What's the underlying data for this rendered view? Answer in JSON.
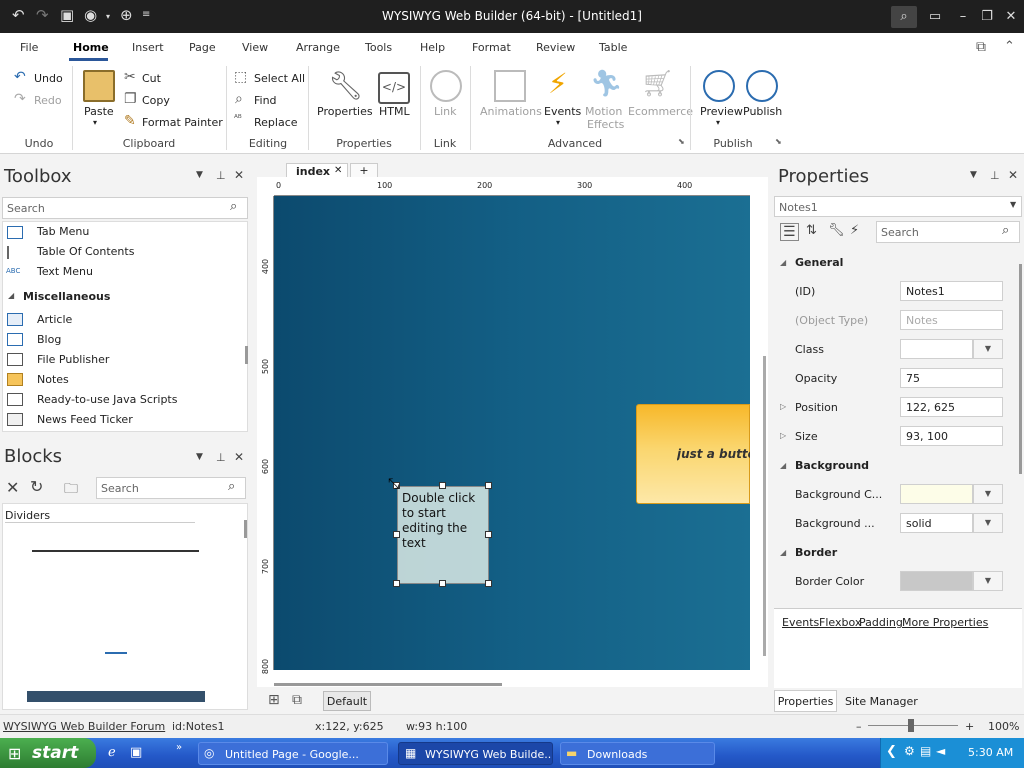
{
  "title": "WYSIWYG Web Builder (64-bit) - [Untitled1]",
  "menu": [
    "File",
    "Home",
    "Insert",
    "Page",
    "View",
    "Arrange",
    "Tools",
    "Help",
    "Format",
    "Review",
    "Table"
  ],
  "ribbon": {
    "undo": "Undo",
    "redo": "Redo",
    "group_undo": "Undo",
    "paste": "Paste",
    "cut": "Cut",
    "copy": "Copy",
    "format_painter": "Format Painter",
    "group_clipboard": "Clipboard",
    "select_all": "Select All",
    "find": "Find",
    "replace": "Replace",
    "group_editing": "Editing",
    "properties": "Properties",
    "html": "HTML",
    "group_properties": "Properties",
    "link": "Link",
    "group_link": "Link",
    "animations": "Animations",
    "events": "Events",
    "motion": "Motion",
    "effects": "Effects",
    "ecommerce": "Ecommerce",
    "group_advanced": "Advanced",
    "preview": "Preview",
    "publish": "Publish",
    "group_publish": "Publish"
  },
  "toolbox": {
    "title": "Toolbox",
    "search_placeholder": "Search",
    "items_top": [
      "Tab Menu",
      "Table Of Contents",
      "Text Menu"
    ],
    "abc": "ABC",
    "category": "Miscellaneous",
    "items": [
      "Article",
      "Blog",
      "File Publisher",
      "Notes",
      "Ready-to-use Java Scripts",
      "News Feed Ticker"
    ]
  },
  "blocks": {
    "title": "Blocks",
    "search_placeholder": "Search",
    "section": "Dividers"
  },
  "tabs": {
    "active": "index",
    "add": "+"
  },
  "ruler": {
    "h": [
      "0",
      "100",
      "200",
      "300",
      "400"
    ],
    "v": [
      "400",
      "500",
      "600",
      "700",
      "800"
    ]
  },
  "canvas": {
    "note_text": "Double click to start editing the text",
    "button_text": "just a button",
    "default_btn": "Default"
  },
  "properties": {
    "title": "Properties",
    "object": "Notes1",
    "search_placeholder": "Search",
    "general": "General",
    "id_label": "(ID)",
    "id_value": "Notes1",
    "type_label": "(Object Type)",
    "type_value": "Notes",
    "class_label": "Class",
    "class_value": "",
    "opacity_label": "Opacity",
    "opacity_value": "75",
    "position_label": "Position",
    "position_value": "122, 625",
    "size_label": "Size",
    "size_value": "93, 100",
    "background": "Background",
    "bgcolor_label": "Background C...",
    "bgcolor_value": "#fdfde8",
    "bgstyle_label": "Background ...",
    "bgstyle_value": "solid",
    "border": "Border",
    "bordercolor_label": "Border Color",
    "bordercolor_value": "#c8c8c8",
    "links": [
      "Events",
      "Flexbox",
      "Padding",
      "More Properties"
    ],
    "bottom_tabs": [
      "Properties",
      "Site Manager"
    ]
  },
  "status": {
    "forum": "WYSIWYG Web Builder Forum",
    "id": "id:Notes1",
    "xy": "x:122, y:625",
    "wh": "w:93 h:100",
    "zoom": "100%"
  },
  "taskbar": {
    "start": "start",
    "tasks": [
      "Untitled Page - Google...",
      "WYSIWYG Web Builde...",
      "Downloads"
    ],
    "time": "5:30 AM"
  }
}
